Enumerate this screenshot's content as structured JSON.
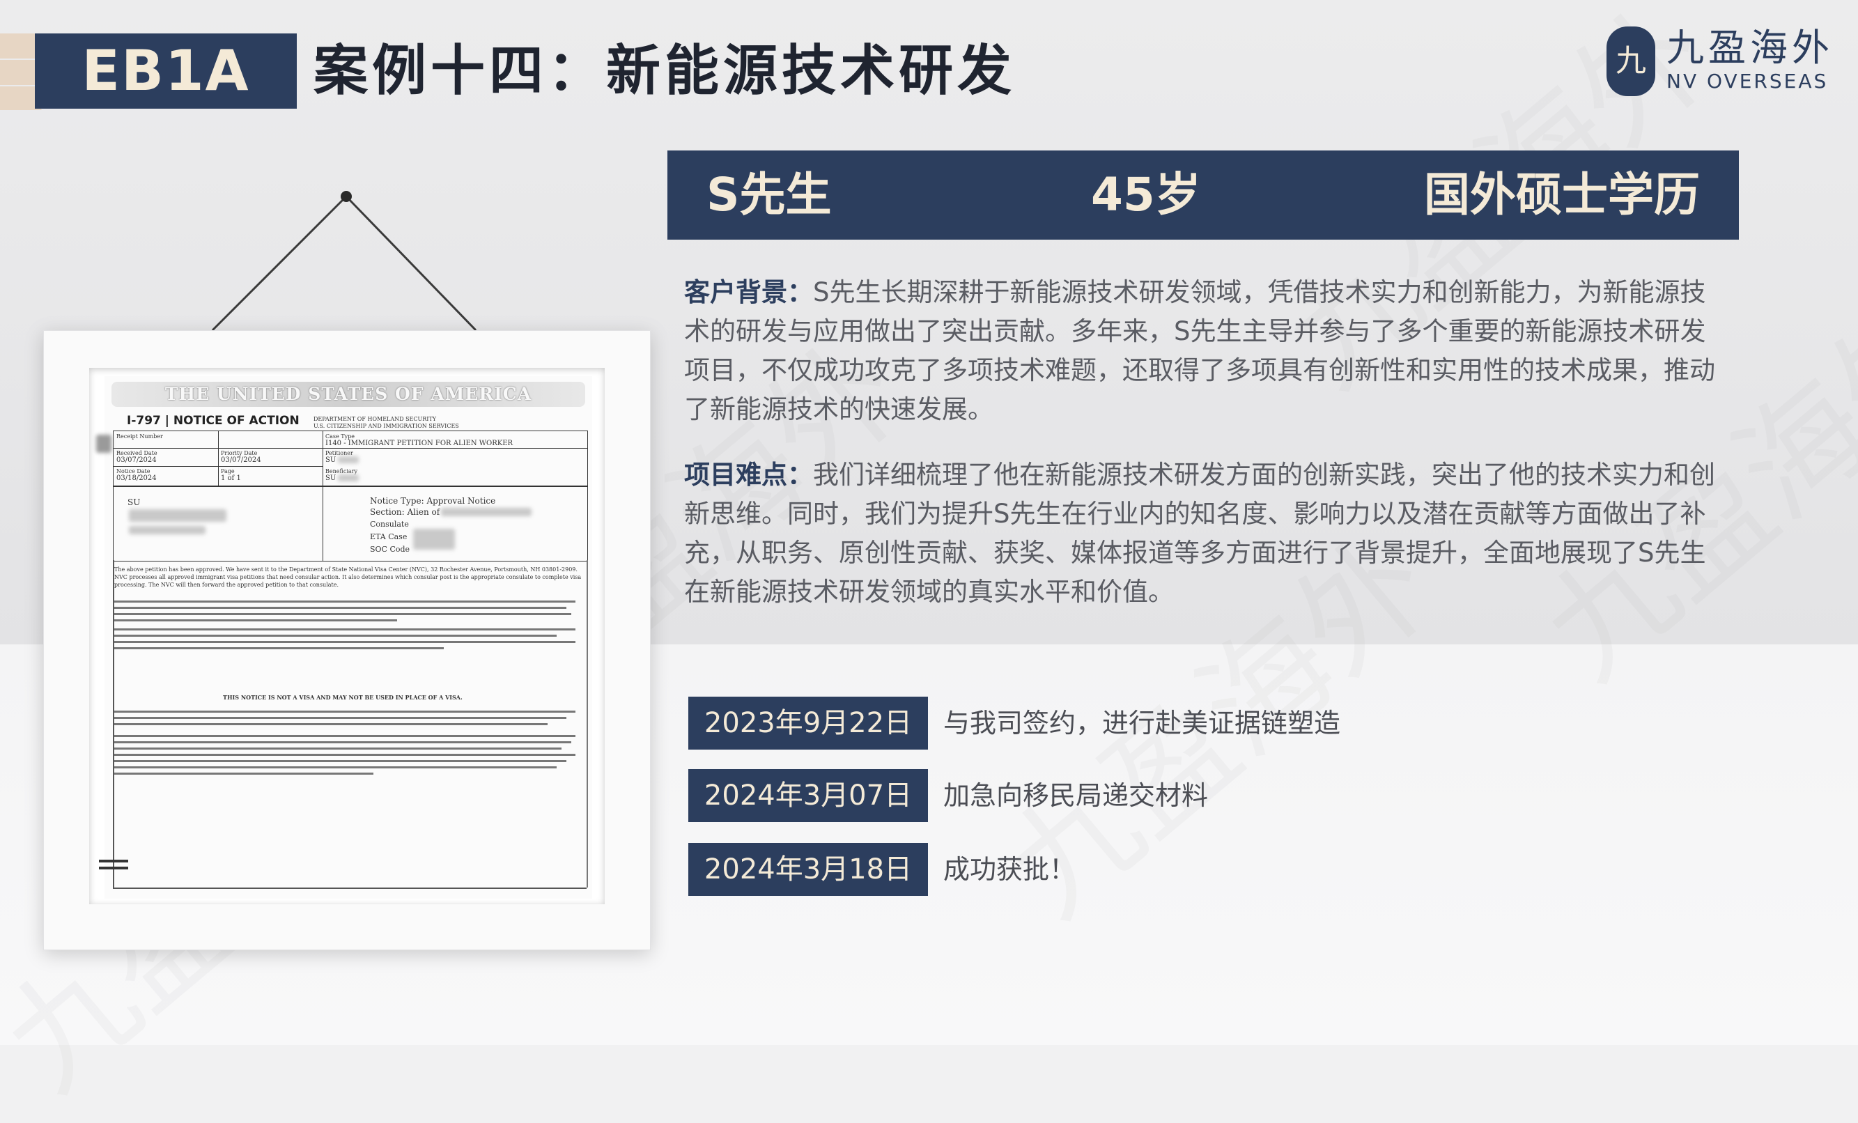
{
  "header": {
    "badge": "EB1A",
    "title": "案例十四：新能源技术研发"
  },
  "logo": {
    "cn": "九盈海外",
    "en": "NV OVERSEAS",
    "mark": "九",
    "icon": "seal-logo-icon"
  },
  "watermark": "九盈海外",
  "banner": {
    "name": "S先生",
    "age": "45岁",
    "education": "国外硕士学历"
  },
  "background": {
    "label": "客户背景：",
    "text": "S先生长期深耕于新能源技术研发领域，凭借技术实力和创新能力，为新能源技术的研发与应用做出了突出贡献。多年来，S先生主导并参与了多个重要的新能源技术研发项目，不仅成功攻克了多项技术难题，还取得了多项具有创新性和实用性的技术成果，推动了新能源技术的快速发展。"
  },
  "difficulty": {
    "label": "项目难点：",
    "text": "我们详细梳理了他在新能源技术研发方面的创新实践，突出了他的技术实力和创新思维。同时，我们为提升S先生在行业内的知名度、影响力以及潜在贡献等方面做出了补充，从职务、原创性贡献、获奖、媒体报道等多方面进行了背景提升，全面地展现了S先生在新能源技术研发领域的真实水平和价值。"
  },
  "timeline": [
    {
      "date": "2023年9月22日",
      "text": "与我司签约，进行赴美证据链塑造"
    },
    {
      "date": "2024年3月07日",
      "text": "加急向移民局递交材料"
    },
    {
      "date": "2024年3月18日",
      "text": "成功获批！"
    }
  ],
  "document": {
    "header": "THE UNITED STATES OF AMERICA",
    "form": "I-797 | NOTICE OF ACTION",
    "dept": "DEPARTMENT OF HOMELAND SECURITY",
    "dept2": "U.S. CITIZENSHIP AND IMMIGRATION SERVICES",
    "case_type_label": "Case Type",
    "case_type": "I140 - IMMIGRANT PETITION FOR ALIEN WORKER",
    "receipt_label": "Receipt Number",
    "received_label": "Received Date",
    "received": "03/07/2024",
    "priority_label": "Priority Date",
    "priority": "03/07/2024",
    "petitioner_label": "Petitioner",
    "petitioner": "SU",
    "notice_date_label": "Notice Date",
    "notice_date": "03/18/2024",
    "page_label": "Page",
    "page": "1 of 1",
    "beneficiary_label": "Beneficiary",
    "beneficiary": "SU",
    "addressee": "SU",
    "notice_type": "Notice Type: Approval Notice",
    "section": "Section: Alien of",
    "consulate": "Consulate",
    "eta_case": "ETA Case",
    "soc_code": "SOC Code",
    "body1": "The above petition has been approved. We have sent it to the Department of State National Visa Center (NVC), 32 Rochester Avenue, Portsmouth, NH 03801-2909. NVC processes all approved immigrant visa petitions that need consular action. It also determines which consular post is the appropriate consulate to complete visa processing. The NVC will then forward the approved petition to that consulate.",
    "body2": "THIS NOTICE IS NOT A VISA AND MAY NOT BE USED IN PLACE OF A VISA."
  }
}
